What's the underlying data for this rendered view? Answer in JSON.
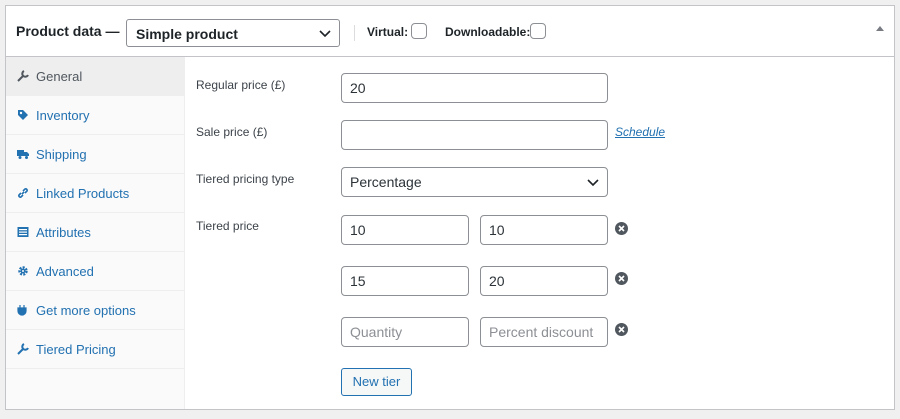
{
  "header": {
    "title": "Product data —",
    "product_type": "Simple product",
    "virtual_label": "Virtual:",
    "downloadable_label": "Downloadable:"
  },
  "sidebar": {
    "items": [
      {
        "label": "General",
        "icon": "wrench-icon",
        "active": true
      },
      {
        "label": "Inventory",
        "icon": "tag-icon"
      },
      {
        "label": "Shipping",
        "icon": "truck-icon"
      },
      {
        "label": "Linked Products",
        "icon": "link-icon"
      },
      {
        "label": "Attributes",
        "icon": "list-icon"
      },
      {
        "label": "Advanced",
        "icon": "gear-icon"
      },
      {
        "label": "Get more options",
        "icon": "plugin-icon"
      },
      {
        "label": "Tiered Pricing",
        "icon": "wrench-icon"
      }
    ]
  },
  "general": {
    "regular_price_label": "Regular price (£)",
    "regular_price_value": "20",
    "sale_price_label": "Sale price (£)",
    "sale_price_value": "",
    "schedule_link": "Schedule",
    "tiered_type_label": "Tiered pricing type",
    "tiered_type_value": "Percentage",
    "tiered_price_label": "Tiered price",
    "tiers": [
      {
        "quantity": "10",
        "discount": "10"
      },
      {
        "quantity": "15",
        "discount": "20"
      }
    ],
    "new_tier": {
      "quantity_placeholder": "Quantity",
      "discount_placeholder": "Percent discount"
    },
    "new_tier_button": "New tier"
  },
  "colors": {
    "accent": "#2271b1",
    "border": "#8c8f94"
  }
}
